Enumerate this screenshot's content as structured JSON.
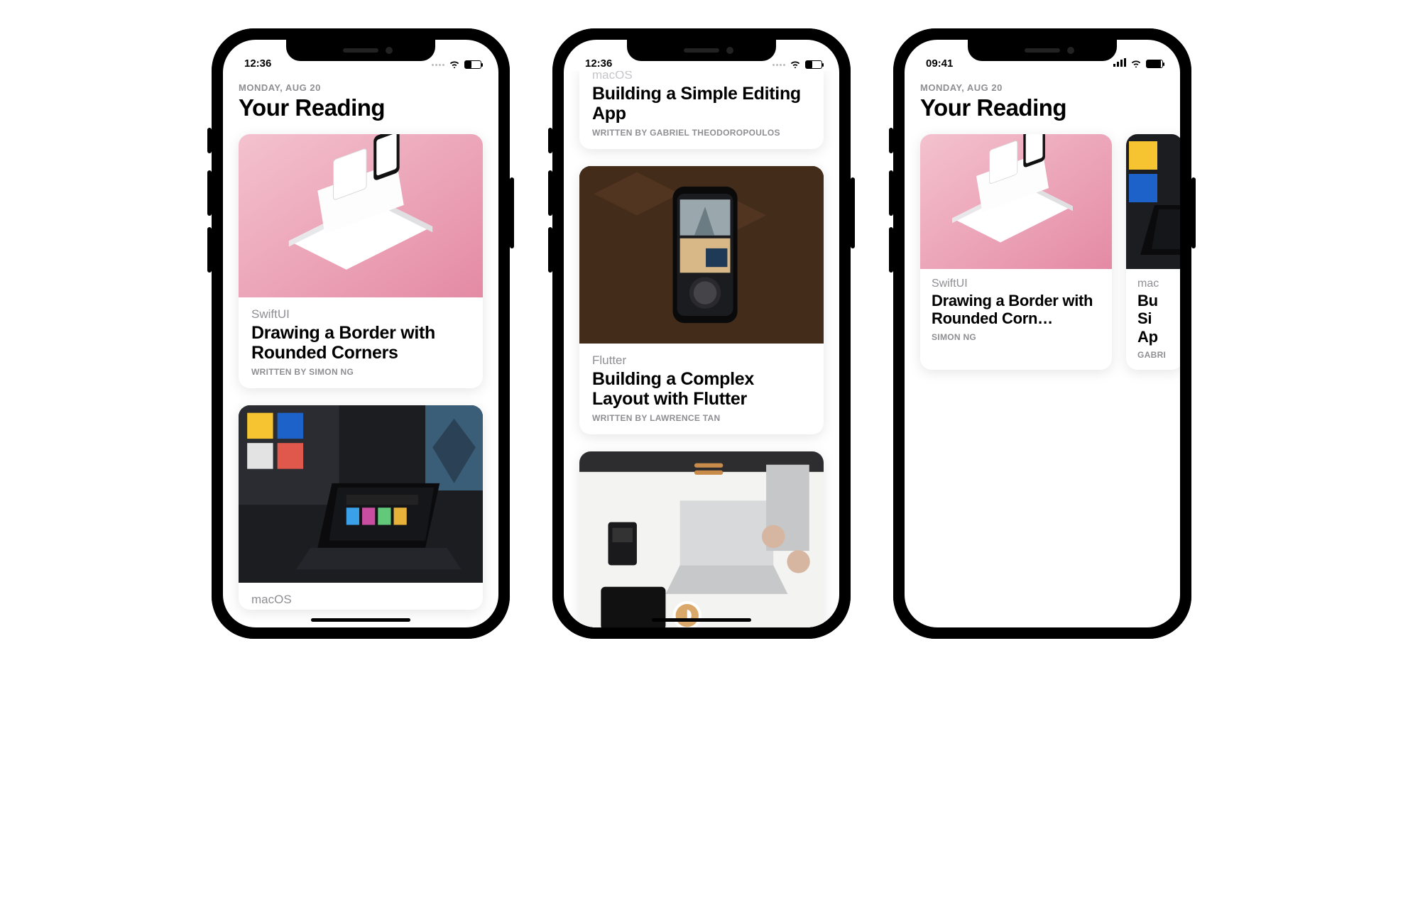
{
  "phone1": {
    "time": "12:36",
    "date": "MONDAY, AUG 20",
    "title": "Your Reading",
    "card1": {
      "category": "SwiftUI",
      "title": "Drawing a Border with Rounded Corners",
      "author": "WRITTEN BY SIMON NG"
    },
    "card2": {
      "category": "macOS"
    }
  },
  "phone2": {
    "time": "12:36",
    "topcard": {
      "category": "macOS",
      "title": "Building a Simple Editing App",
      "author": "WRITTEN BY GABRIEL THEODOROPOULOS"
    },
    "card1": {
      "category": "Flutter",
      "title": "Building a Complex Layout with Flutter",
      "author": "WRITTEN BY LAWRENCE TAN"
    }
  },
  "phone3": {
    "time": "09:41",
    "date": "MONDAY, AUG 20",
    "title": "Your Reading",
    "carousel": [
      {
        "category": "SwiftUI",
        "title": "Drawing a Border with Rounded Corn…",
        "author": "SIMON NG"
      },
      {
        "category": "mac",
        "title_l1": "Bu",
        "title_l2": "Si",
        "title_l3": "Ap",
        "author": "GABRI"
      }
    ]
  }
}
